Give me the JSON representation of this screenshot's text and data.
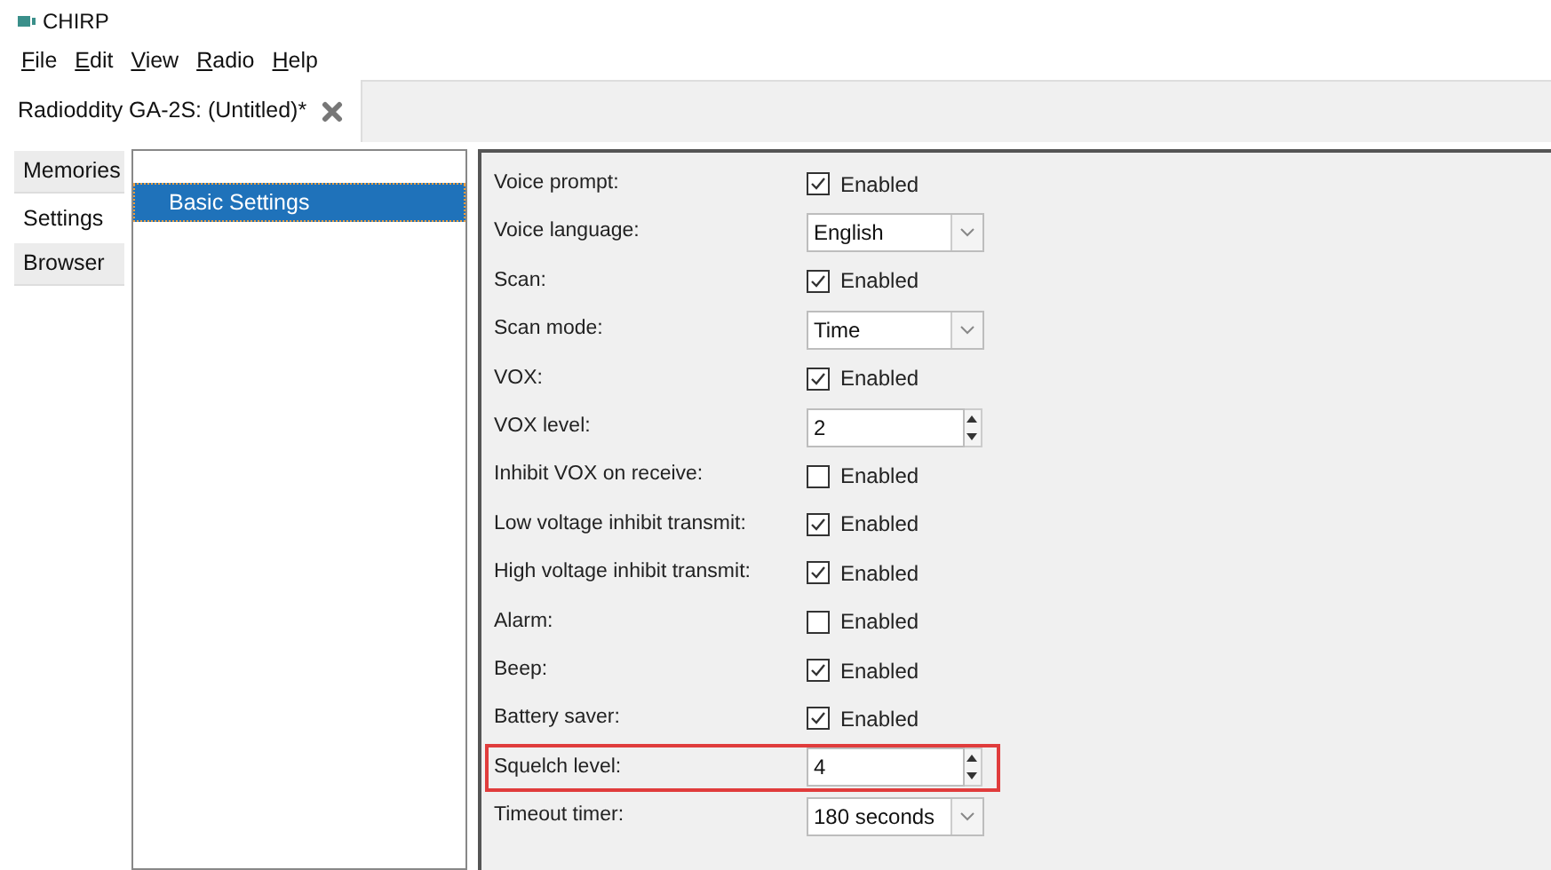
{
  "window": {
    "title": "CHIRP"
  },
  "menu": [
    "File",
    "Edit",
    "View",
    "Radio",
    "Help"
  ],
  "document_tabs": [
    {
      "label": "Radioddity GA-2S: (Untitled)*",
      "selected": true
    }
  ],
  "side_tabs": [
    {
      "label": "Memories",
      "selected": false
    },
    {
      "label": "Settings",
      "selected": true
    },
    {
      "label": "Browser",
      "selected": false
    }
  ],
  "groups": [
    {
      "label": "Basic Settings",
      "selected": true
    }
  ],
  "settings": [
    {
      "label": "Voice prompt:",
      "kind": "checkbox",
      "checked": true,
      "text": "Enabled",
      "highlighted": false
    },
    {
      "label": "Voice language:",
      "kind": "select",
      "value": "English",
      "highlighted": false
    },
    {
      "label": "Scan:",
      "kind": "checkbox",
      "checked": true,
      "text": "Enabled",
      "highlighted": false
    },
    {
      "label": "Scan mode:",
      "kind": "select",
      "value": "Time",
      "highlighted": false
    },
    {
      "label": "VOX:",
      "kind": "checkbox",
      "checked": true,
      "text": "Enabled",
      "highlighted": false
    },
    {
      "label": "VOX level:",
      "kind": "spin",
      "value": "2",
      "highlighted": false
    },
    {
      "label": "Inhibit VOX on receive:",
      "kind": "checkbox",
      "checked": false,
      "text": "Enabled",
      "highlighted": false
    },
    {
      "label": "Low voltage inhibit transmit:",
      "kind": "checkbox",
      "checked": true,
      "text": "Enabled",
      "highlighted": false
    },
    {
      "label": "High voltage inhibit transmit:",
      "kind": "checkbox",
      "checked": true,
      "text": "Enabled",
      "highlighted": false
    },
    {
      "label": "Alarm:",
      "kind": "checkbox",
      "checked": false,
      "text": "Enabled",
      "highlighted": false
    },
    {
      "label": "Beep:",
      "kind": "checkbox",
      "checked": true,
      "text": "Enabled",
      "highlighted": false
    },
    {
      "label": "Battery saver:",
      "kind": "checkbox",
      "checked": true,
      "text": "Enabled",
      "highlighted": false
    },
    {
      "label": "Squelch level:",
      "kind": "spin",
      "value": "4",
      "highlighted": true
    },
    {
      "label": "Timeout timer:",
      "kind": "select",
      "value": "180 seconds",
      "highlighted": false
    }
  ]
}
